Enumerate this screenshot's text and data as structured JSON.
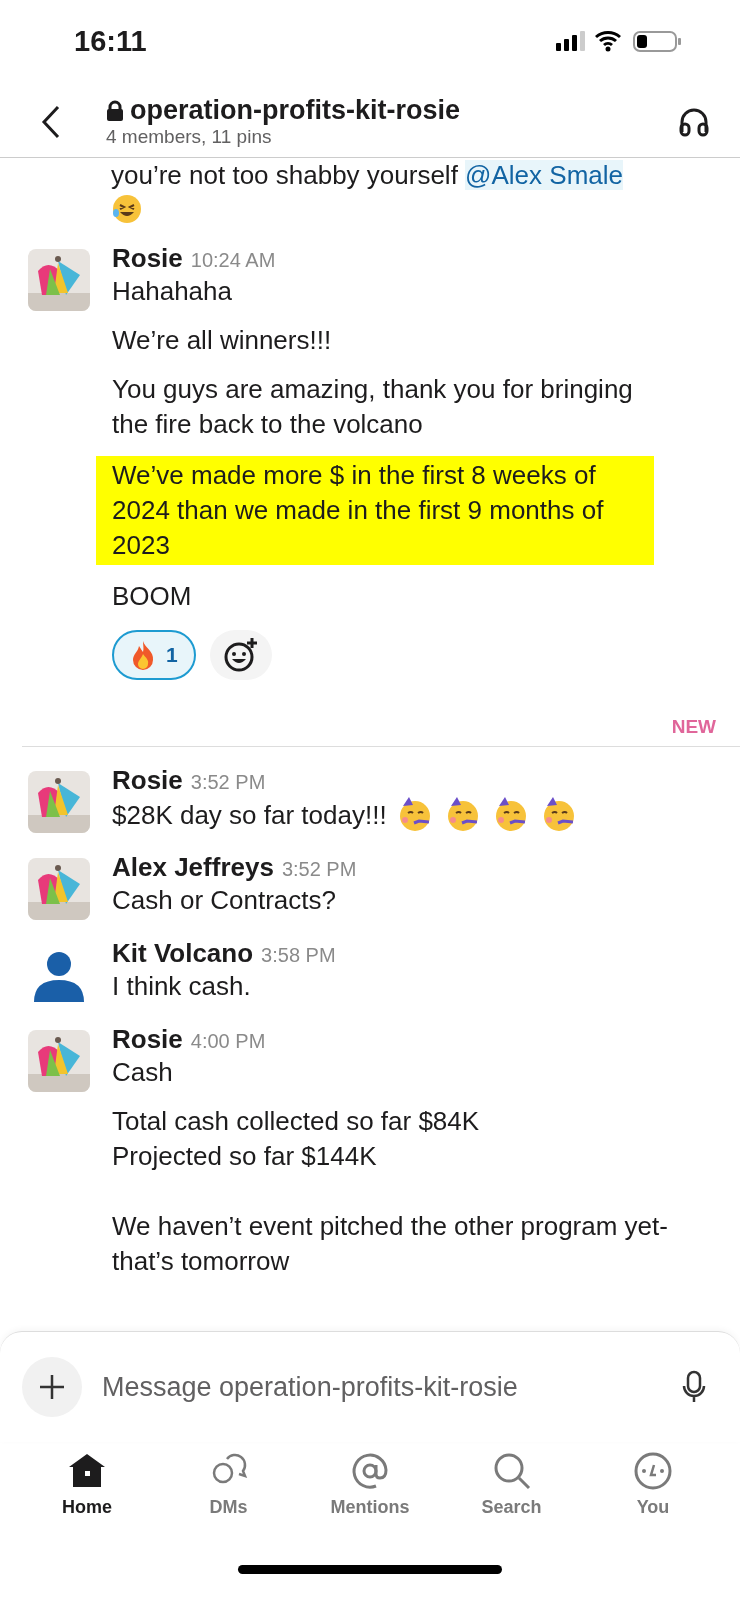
{
  "status_bar": {
    "time": "16:11"
  },
  "header": {
    "channel": "operation-profits-kit-rosie",
    "subtitle": "4 members, 11 pins",
    "private": true
  },
  "partial_message": {
    "text": "you’re not too shabby yourself",
    "mention": "@Alex Smale"
  },
  "messages": [
    {
      "author": "Rosie",
      "time": "10:24 AM",
      "default_avatar": false,
      "paragraphs": [
        {
          "text": "Hahahaha",
          "highlighted": false
        },
        {
          "text": "We’re all winners!!!",
          "highlighted": false
        },
        {
          "text": "You guys are amazing, thank you for bringing the fire back to the volcano",
          "highlighted": false
        },
        {
          "text": "We’ve made more $ in the first 8 weeks of 2024 than we made in the first 9 months of 2023",
          "highlighted": true
        },
        {
          "text": "BOOM",
          "highlighted": false
        }
      ],
      "reactions": [
        {
          "count": "1",
          "selected": true
        }
      ]
    },
    {
      "kind": "divider",
      "label": "NEW"
    },
    {
      "author": "Rosie",
      "time": "3:52 PM",
      "default_avatar": false,
      "paragraphs": [
        {
          "text": "$28K day so far today!!!",
          "highlighted": false
        }
      ]
    },
    {
      "author": "Alex Jeffreys",
      "time": "3:52 PM",
      "default_avatar": false,
      "paragraphs": [
        {
          "text": "Cash or Contracts?",
          "highlighted": false
        }
      ]
    },
    {
      "author": "Kit Volcano",
      "time": "3:58 PM",
      "default_avatar": true,
      "paragraphs": [
        {
          "text": "I think cash.",
          "highlighted": false
        }
      ]
    },
    {
      "author": "Rosie",
      "time": "4:00 PM",
      "default_avatar": false,
      "paragraphs": [
        {
          "text": "Cash",
          "highlighted": false
        },
        {
          "text": "Total cash collected so far $84K\nProjected so far $144K\n\nWe haven’t event pitched the other program yet- that’s tomorrow",
          "highlighted": false
        }
      ]
    }
  ],
  "composer": {
    "placeholder": "Message operation-profits-kit-rosie"
  },
  "tabs": [
    {
      "label": "Home",
      "selected": true
    },
    {
      "label": "DMs",
      "selected": false
    },
    {
      "label": "Mentions",
      "selected": false
    },
    {
      "label": "Search",
      "selected": false
    },
    {
      "label": "You",
      "selected": false
    }
  ]
}
